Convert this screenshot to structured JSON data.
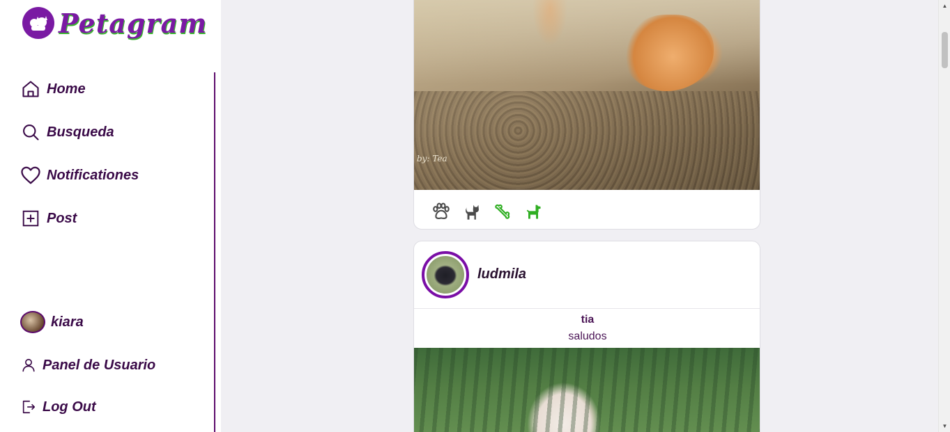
{
  "app": {
    "name": "Petagram",
    "accent": "#7a1aa3",
    "text_color": "#3a0a48",
    "logo_shadow": "#3bb32f"
  },
  "sidebar": {
    "items": [
      {
        "label": "Home",
        "icon": "home-icon"
      },
      {
        "label": "Busqueda",
        "icon": "search-icon"
      },
      {
        "label": "Notificationes",
        "icon": "heart-icon"
      },
      {
        "label": "Post",
        "icon": "plus-square-icon"
      }
    ],
    "user": {
      "name": "kiara"
    },
    "panel": {
      "label": "Panel de Usuario",
      "icon": "user-icon"
    },
    "logout": {
      "label": "Log Out",
      "icon": "logout-icon"
    }
  },
  "feed": {
    "post1": {
      "watermark": "by: Tea",
      "actions": [
        {
          "name": "paw-icon",
          "color": "#4a4a4a"
        },
        {
          "name": "cat-icon",
          "color": "#4a4a4a"
        },
        {
          "name": "bone-icon",
          "color": "#2fae22"
        },
        {
          "name": "dog-icon",
          "color": "#2fae22"
        }
      ]
    },
    "post2": {
      "username": "ludmila",
      "title": "tia",
      "caption": "saludos"
    }
  }
}
